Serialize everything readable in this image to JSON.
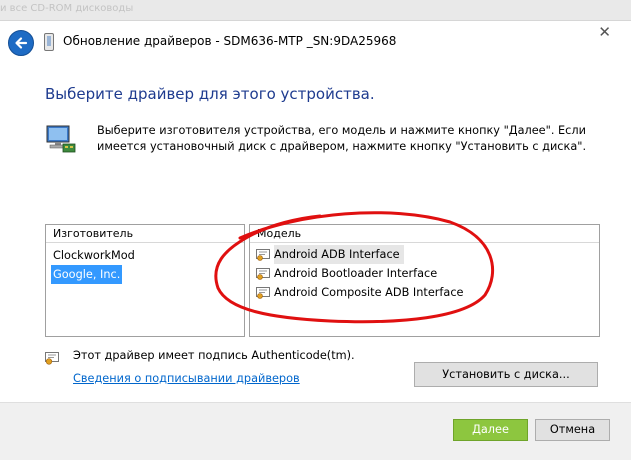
{
  "background": {
    "fragment_text": "и все CD-ROM дисководы"
  },
  "window": {
    "title": "Обновление драйверов - SDM636-MTP _SN:9DA25968",
    "close_glyph": "✕"
  },
  "main": {
    "heading": "Выберите драйвер для этого устройства.",
    "description": "Выберите изготовителя устройства, его модель и нажмите кнопку \"Далее\". Если имеется установочный диск с  драйвером, нажмите кнопку \"Установить с диска\"."
  },
  "manufacturer": {
    "header": "Изготовитель",
    "items": [
      "ClockworkMod",
      "Google, Inc."
    ],
    "selected": "Google, Inc."
  },
  "model": {
    "header": "Модель",
    "items": [
      "Android ADB Interface",
      "Android Bootloader Interface",
      "Android Composite ADB Interface"
    ]
  },
  "signature": {
    "text": "Этот драйвер имеет подпись Authenticode(tm).",
    "link": "Сведения о подписывании драйверов"
  },
  "buttons": {
    "have_disk": "Установить с диска...",
    "next": "Далее",
    "cancel": "Отмена"
  },
  "colors": {
    "heading": "#1e3b8f",
    "selection": "#3399ff",
    "next_button": "#8dc63f",
    "annotation": "#e01010"
  }
}
